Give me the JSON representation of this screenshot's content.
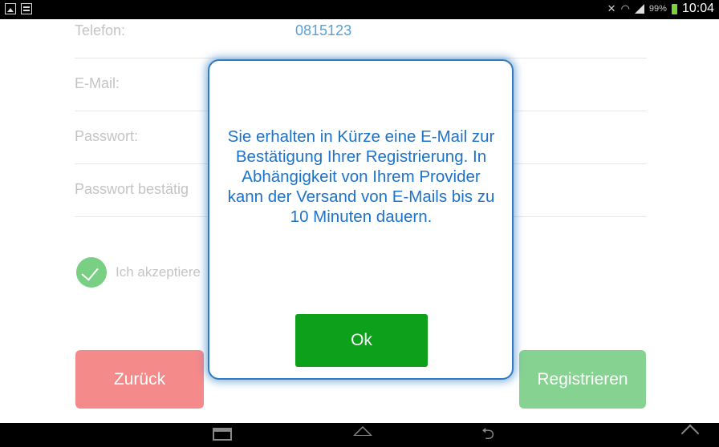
{
  "status_bar": {
    "right_indicator": "99%",
    "time": "10:04"
  },
  "form": {
    "fields": [
      {
        "label": "Telefon:",
        "value": "0815123"
      },
      {
        "label": "E-Mail:",
        "value": ""
      },
      {
        "label": "Passwort:",
        "value": ""
      },
      {
        "label": "Passwort bestätig",
        "value": ""
      }
    ],
    "accept_label": "Ich akzeptiere",
    "back_button": "Zurück",
    "register_button": "Registrieren"
  },
  "dialog": {
    "message": "Sie erhalten in Kürze eine E-Mail zur Bestätigung Ihrer Registrierung. In Abhängigkeit von Ihrem Provider kann der Versand von E-Mails bis zu 10 Minuten dauern.",
    "ok_button": "Ok"
  },
  "colors": {
    "accent_blue": "#1d73c9",
    "ok_green": "#0ca01b",
    "back_red": "#f58a8a",
    "register_green": "#86d391"
  }
}
